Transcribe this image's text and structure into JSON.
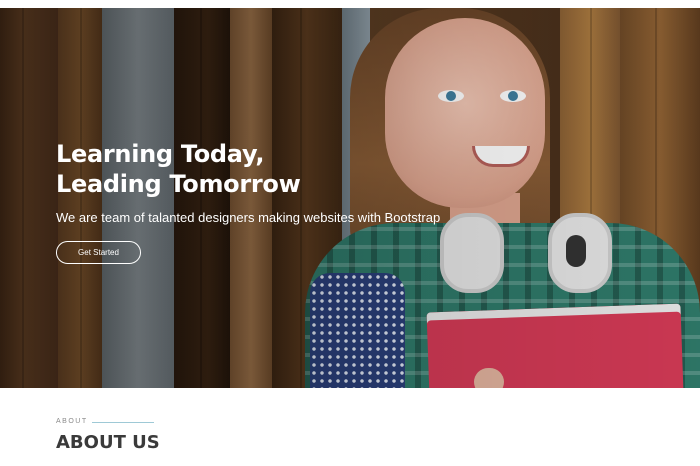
{
  "hero": {
    "title_line1": "Learning Today,",
    "title_line2": "Leading Tomorrow",
    "subtitle": "We are team of talanted designers making websites with Bootstrap",
    "cta_label": "Get Started"
  },
  "about": {
    "eyebrow": "ABOUT",
    "heading": "ABOUT US"
  },
  "colors": {
    "hero_text": "#ffffff",
    "book": "#d43a56",
    "eyebrow_line": "#9ec9d6",
    "heading_text": "#3a3a3a"
  }
}
